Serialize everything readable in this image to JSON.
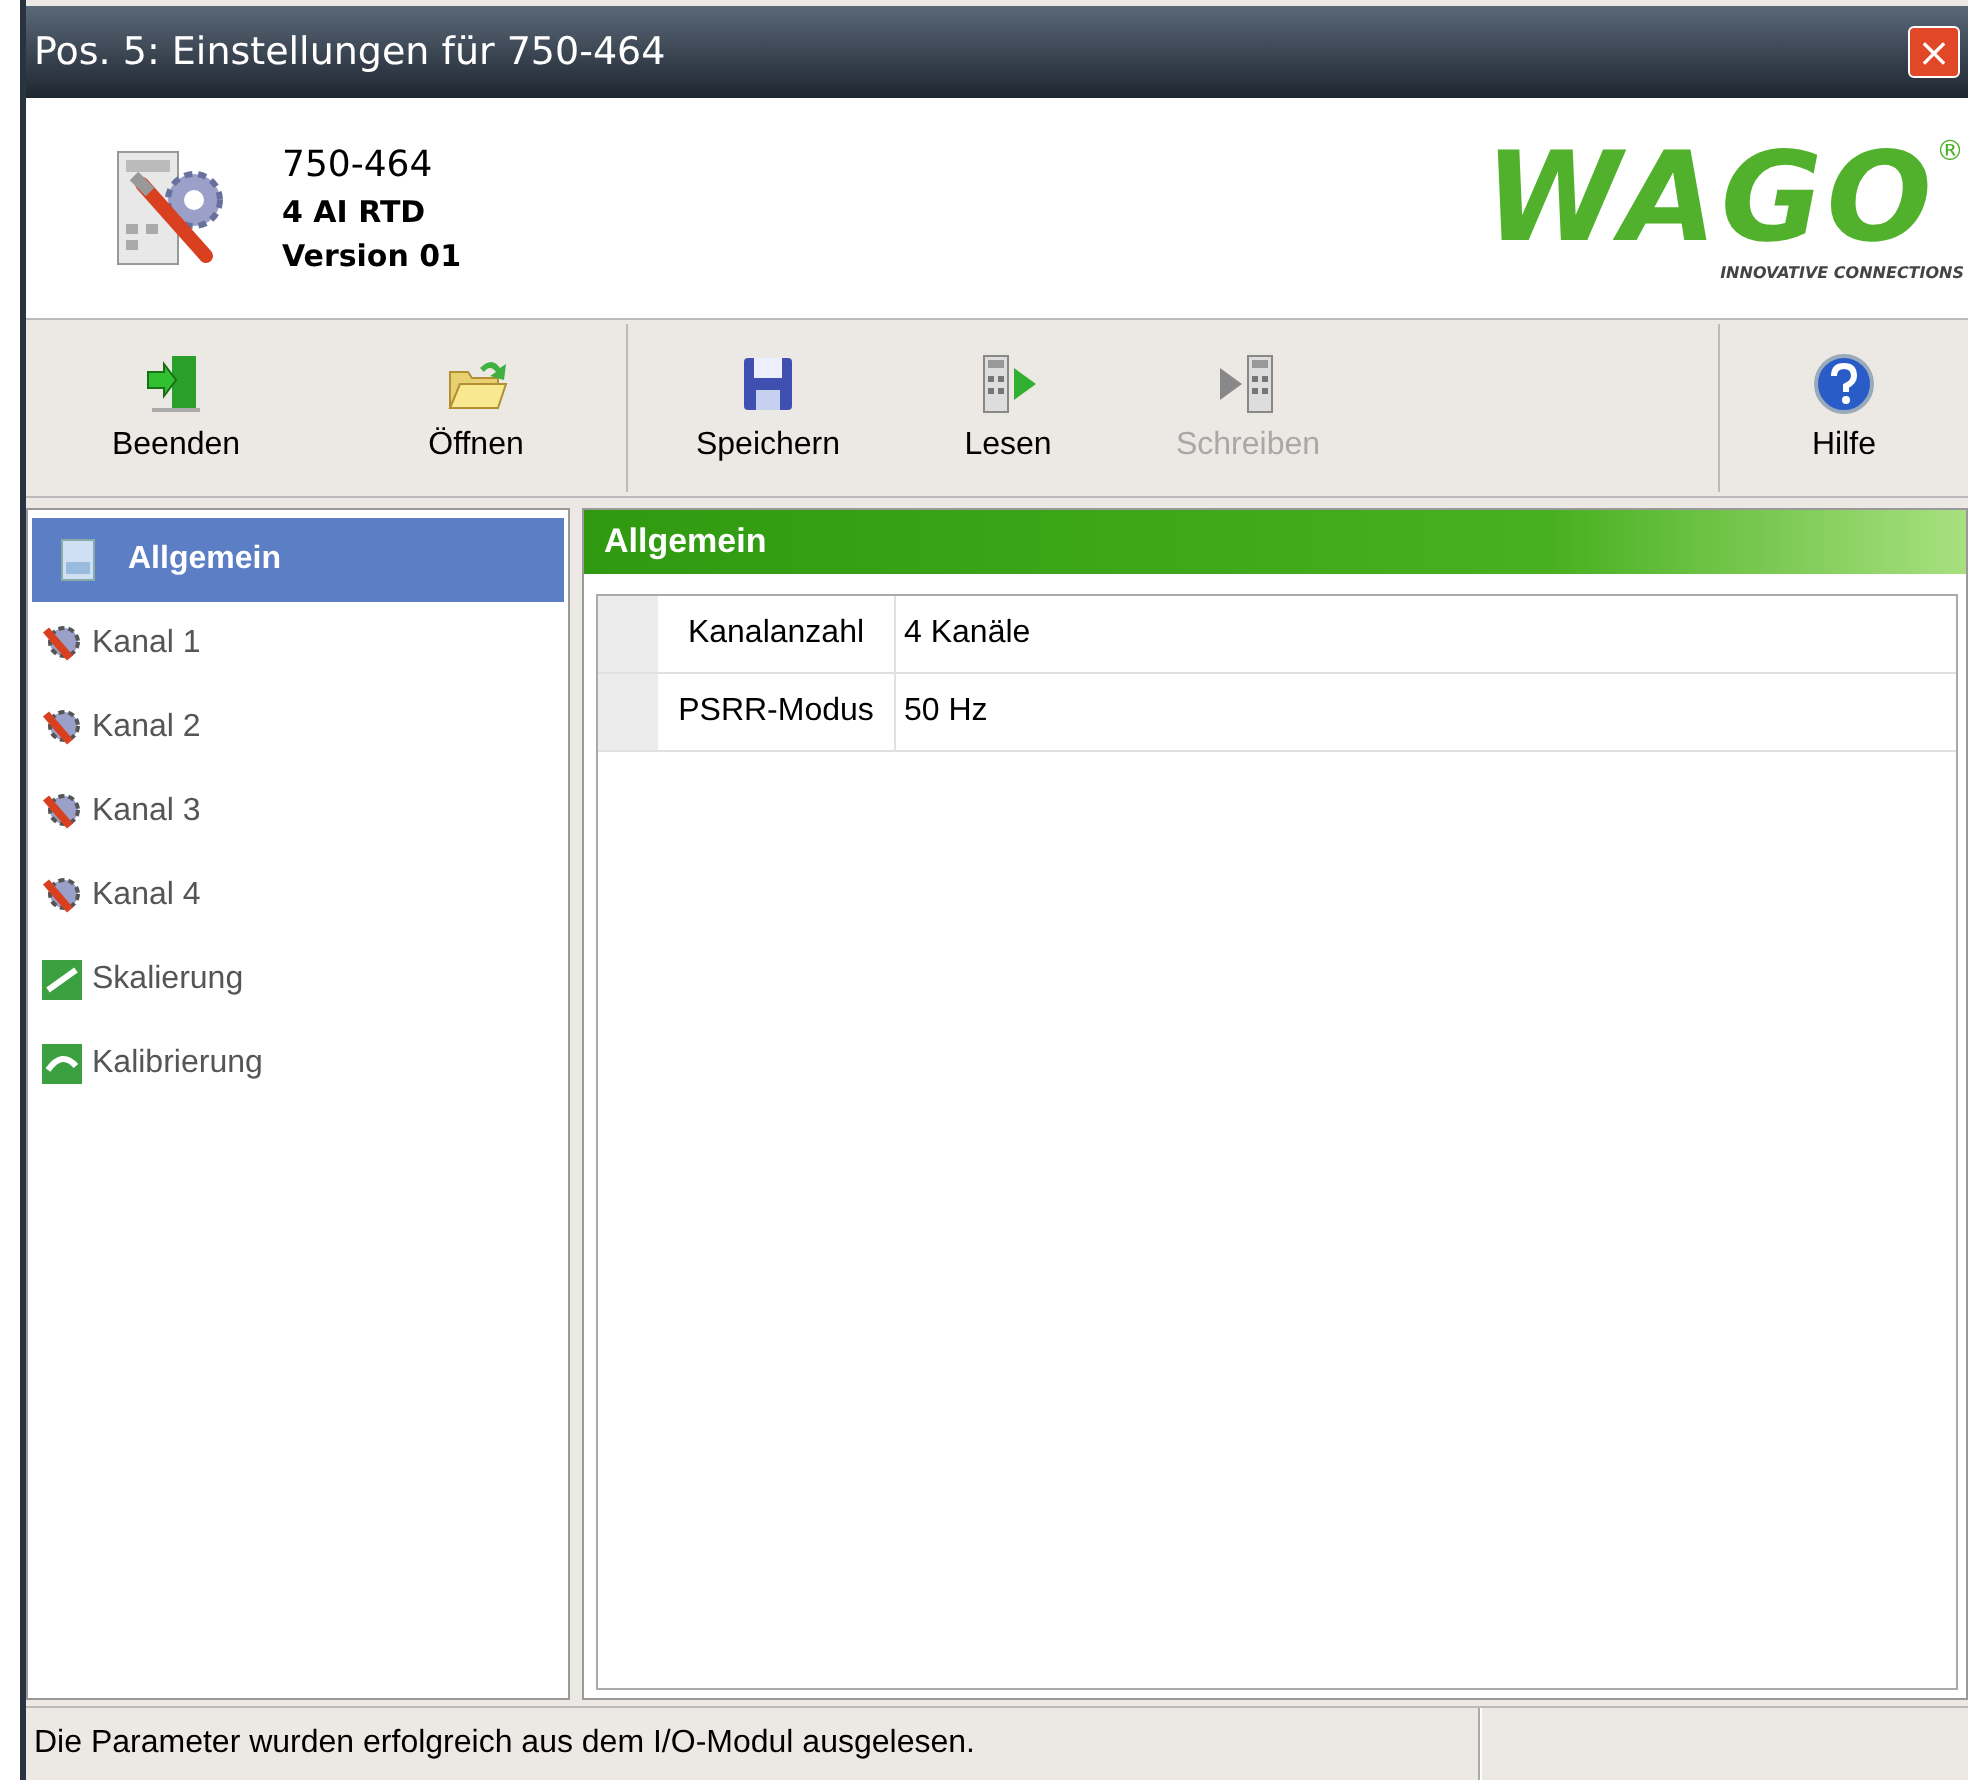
{
  "window": {
    "title": "Pos. 5: Einstellungen für 750-464",
    "close": "×"
  },
  "header": {
    "lines": [
      "750-464",
      "4 AI RTD",
      "Version 01"
    ],
    "logo": {
      "text": "WAGO",
      "registered": "®",
      "tagline": "INNOVATIVE CONNECTIONS"
    }
  },
  "toolbar": [
    {
      "label": "Beenden",
      "kind": "exit",
      "disabled": false
    },
    {
      "label": "Öffnen",
      "kind": "open",
      "disabled": false
    },
    {
      "label": "Speichern",
      "kind": "save",
      "disabled": false
    },
    {
      "label": "Lesen",
      "kind": "read",
      "disabled": false
    },
    {
      "label": "Schreiben",
      "kind": "write",
      "disabled": true
    },
    {
      "label": "Hilfe",
      "kind": "help",
      "disabled": false
    }
  ],
  "sidebar": {
    "items": [
      {
        "label": "Allgemein",
        "kind": "general",
        "selected": true
      },
      {
        "label": "Kanal 1",
        "kind": "channel",
        "selected": false
      },
      {
        "label": "Kanal 2",
        "kind": "channel",
        "selected": false
      },
      {
        "label": "Kanal 3",
        "kind": "channel",
        "selected": false
      },
      {
        "label": "Kanal 4",
        "kind": "channel",
        "selected": false
      },
      {
        "label": "Skalierung",
        "kind": "sca",
        "selected": false
      },
      {
        "label": "Kalibrierung",
        "kind": "cal",
        "selected": false
      }
    ]
  },
  "panel": {
    "title": "Allgemein",
    "rows": [
      {
        "name": "Kanalanzahl",
        "value": "4 Kanäle"
      },
      {
        "name": "PSRR-Modus",
        "value": "50 Hz"
      }
    ]
  },
  "status_bar": {
    "message": "Die Parameter wurden erfolgreich aus dem I/O-Modul ausgelesen."
  }
}
